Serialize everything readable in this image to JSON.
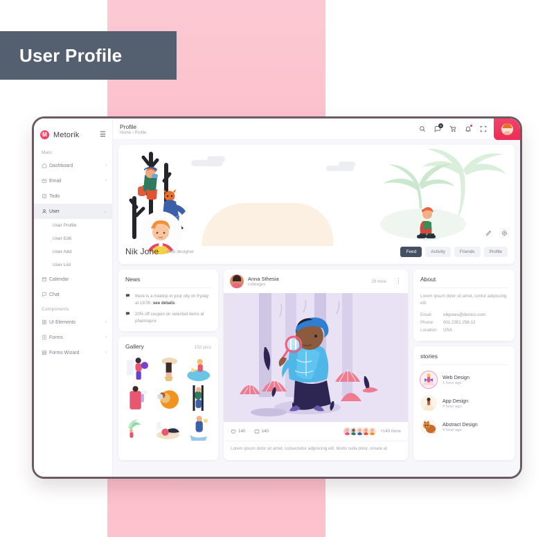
{
  "badge": {
    "label": "User Profile"
  },
  "brand": {
    "name": "Metorik",
    "logo_letter": "M",
    "menu_icon": "hamburger-icon"
  },
  "colors": {
    "accent": "#ef2d56",
    "badge_bg": "#546070",
    "pink_band": "#fbb9c6",
    "tab_active_bg": "#465063",
    "sidebar_active_bg": "#eff0f4"
  },
  "sidebar": {
    "sections": [
      {
        "caption": "Main",
        "items": [
          {
            "label": "Dashboard",
            "icon": "home-icon",
            "chevron": "›"
          },
          {
            "label": "Email",
            "icon": "envelope-icon",
            "chevron": "›"
          },
          {
            "label": "Todo",
            "icon": "checkbox-icon",
            "chevron": ""
          },
          {
            "label": "User",
            "icon": "user-icon",
            "chevron": "⌄",
            "active": true
          },
          {
            "label": "Calendar",
            "icon": "calendar-icon",
            "chevron": ""
          },
          {
            "label": "Chat",
            "icon": "chat-icon",
            "chevron": ""
          }
        ],
        "subitems": [
          "User Profile",
          "User Edit",
          "User Add",
          "User List"
        ]
      },
      {
        "caption": "Components",
        "items": [
          {
            "label": "UI Elements",
            "icon": "grid-icon",
            "chevron": "›"
          },
          {
            "label": "Forms",
            "icon": "form-icon",
            "chevron": "›"
          },
          {
            "label": "Forms Wizard",
            "icon": "wizard-icon",
            "chevron": "›"
          }
        ]
      }
    ]
  },
  "topbar": {
    "title": "Profile",
    "breadcrumb_home": "Home",
    "breadcrumb_sep": "›",
    "breadcrumb_current": "Profile",
    "icons": [
      {
        "name": "search-icon",
        "badge": ""
      },
      {
        "name": "messages-icon",
        "badge": "9"
      },
      {
        "name": "cart-icon",
        "badge": ""
      },
      {
        "name": "bell-icon",
        "badge": ""
      },
      {
        "name": "fullscreen-icon",
        "badge": ""
      }
    ],
    "avatar": "user-avatar"
  },
  "banner": {
    "name": "Nik Jone",
    "role": "- Web designer",
    "edit_icon": "pencil-icon",
    "settings_icon": "gear-icon",
    "tabs": [
      {
        "label": "Feed",
        "active": true
      },
      {
        "label": "Activity",
        "active": false
      },
      {
        "label": "Friends",
        "active": false
      },
      {
        "label": "Profile",
        "active": false
      }
    ]
  },
  "news": {
    "title": "News",
    "items": [
      {
        "icon": "news-flag-icon",
        "text": "there is a meetup in your city on fryday at 19:00.",
        "link": "see details"
      },
      {
        "icon": "news-flag-icon",
        "text": "20% off coupon on selected items at pharmaprix",
        "link": ""
      }
    ]
  },
  "gallery": {
    "title": "Gallery",
    "count": "132 pics",
    "cells": 9
  },
  "post": {
    "author": "Anna Sthesia",
    "relation": "colleages",
    "time": "29 mins",
    "menu_icon": "more-vertical-icon",
    "likes": "140",
    "comments": "140",
    "like_icon": "heart-icon",
    "comment_icon": "comment-icon",
    "more_people": "+140 more",
    "text": "Lorem ipsum dolor sit amet, consectetur adipiscing elit. Morbi nulla dolor, ornare at"
  },
  "about": {
    "title": "About",
    "description": "Lorem ipsum dolor sit amet, contur adipiscing elit.",
    "rows": [
      {
        "key": "Email:",
        "value": "nikjones@demco.com"
      },
      {
        "key": "Phone:",
        "value": "001 2351 256 12"
      },
      {
        "key": "Location:",
        "value": "USA"
      }
    ]
  },
  "stories": {
    "title": "stories",
    "items": [
      {
        "name": "Web Design",
        "time": "1 hour ago",
        "avatar": "story-avatar-dancer"
      },
      {
        "name": "App Design",
        "time": "4 hour ago",
        "avatar": "story-avatar-person"
      },
      {
        "name": "Abstract Design",
        "time": "9 hour ago",
        "avatar": "story-avatar-fox"
      }
    ]
  }
}
